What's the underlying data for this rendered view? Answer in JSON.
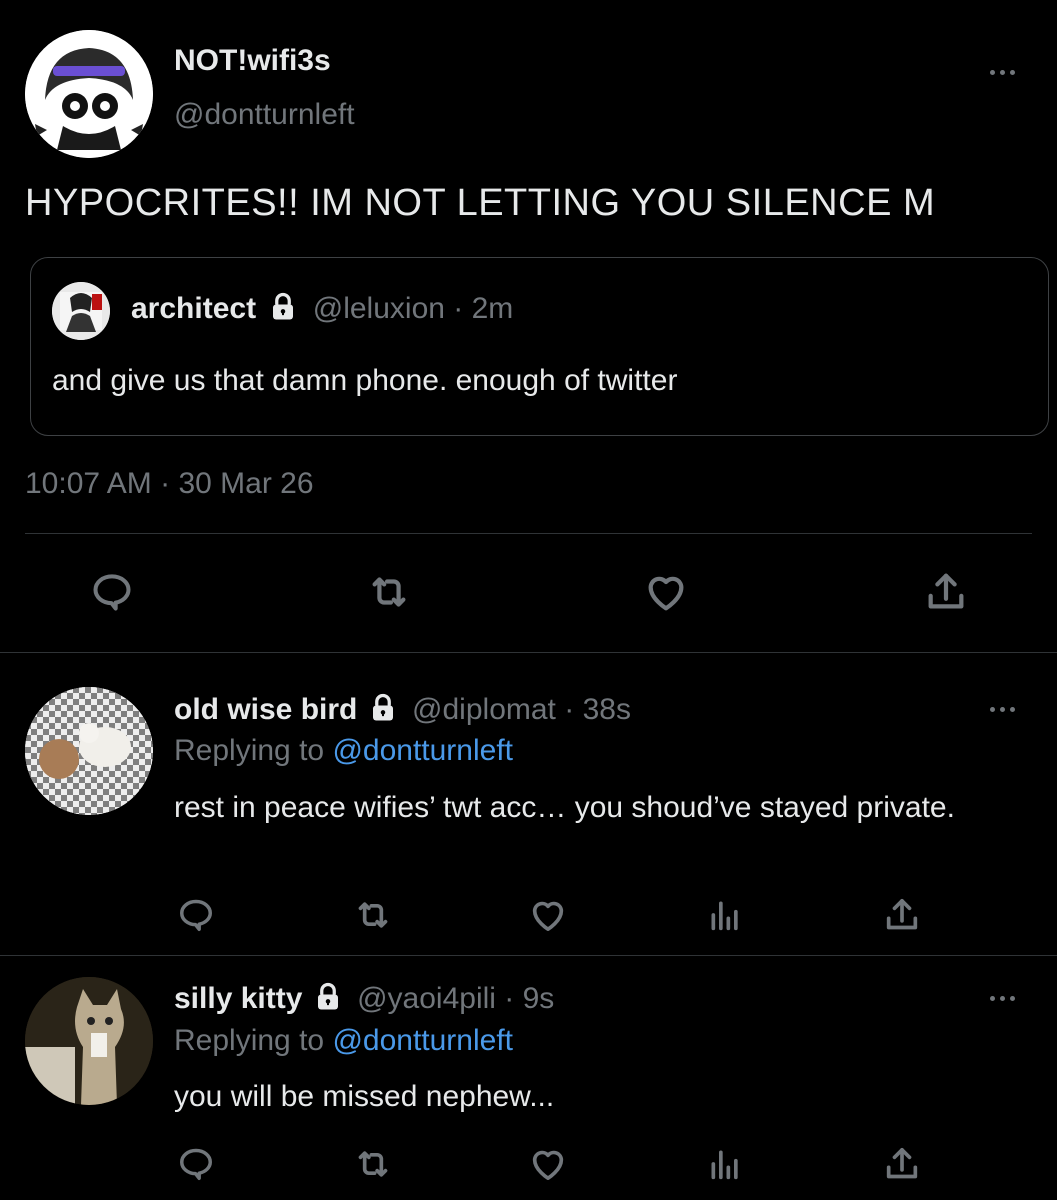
{
  "main_tweet": {
    "display_name": "NOT!wifi3s",
    "handle": "@dontturnleft",
    "text": "HYPOCRITES!! IM NOT LETTING YOU SILENCE M",
    "time": "10:07 AM",
    "date": "30 Mar 26",
    "quoted": {
      "display_name": "architect",
      "handle": "@leluxion",
      "age": "· 2m",
      "text": "and give us that damn phone. enough of twitter"
    }
  },
  "replies": [
    {
      "display_name": "old wise bird",
      "handle": "@diplomat",
      "age": "· 38s",
      "replying_prefix": "Replying to",
      "replying_to": "@dontturnleft",
      "text": "rest in peace wifies’ twt acc… you shoud’ve stayed private."
    },
    {
      "display_name": "silly kitty",
      "handle": "@yaoi4pili",
      "age": "· 9s",
      "replying_prefix": "Replying to",
      "replying_to": "@dontturnleft",
      "text": "you will be missed nephew..."
    }
  ],
  "colors": {
    "background": "#000000",
    "text": "#e7e9ea",
    "muted": "#71767b",
    "link": "#4a99e9",
    "divider": "#2f3336"
  }
}
